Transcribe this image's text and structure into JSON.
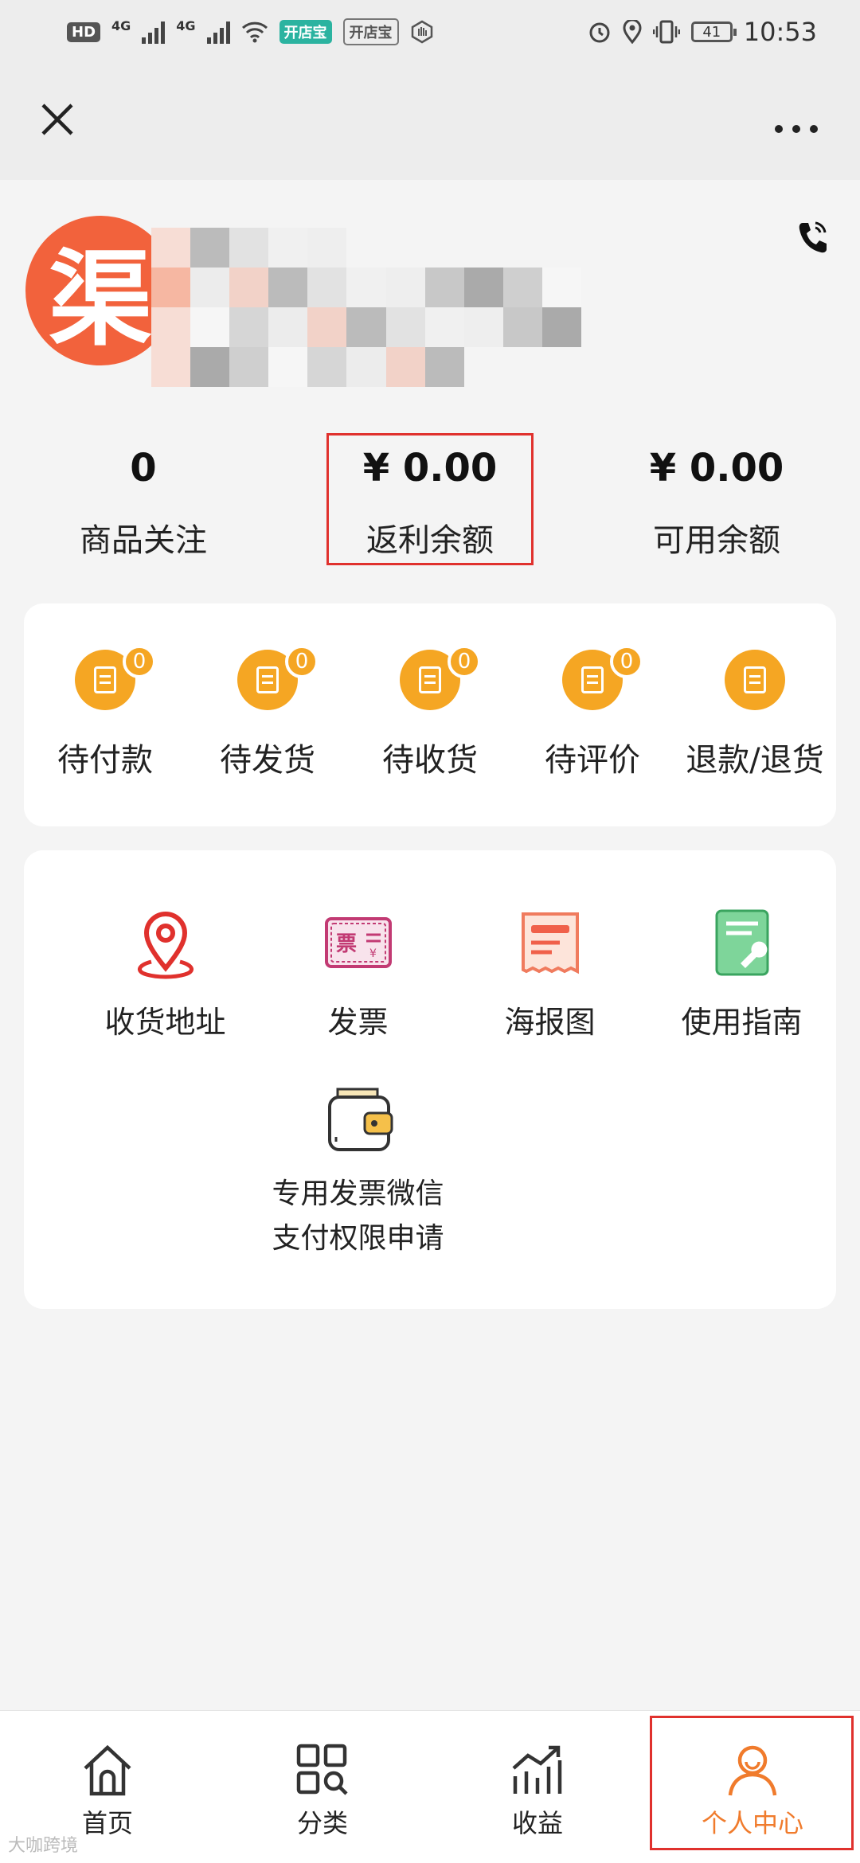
{
  "status_bar": {
    "hd_label": "HD",
    "network_1": "4G",
    "network_2": "4G",
    "app_chip_1": "开店宝",
    "app_chip_2": "开店宝",
    "battery": "41",
    "time": "10:53"
  },
  "nav": {
    "close_icon": "close-icon",
    "more_icon": "more-icon"
  },
  "profile": {
    "avatar_text": "渠",
    "phone_icon": "phone-icon"
  },
  "stats": [
    {
      "value": "0",
      "label": "商品关注"
    },
    {
      "value": "¥ 0.00",
      "label": "返利余额"
    },
    {
      "value": "¥ 0.00",
      "label": "可用余额"
    }
  ],
  "orders": [
    {
      "label": "待付款",
      "badge": "0"
    },
    {
      "label": "待发货",
      "badge": "0"
    },
    {
      "label": "待收货",
      "badge": "0"
    },
    {
      "label": "待评价",
      "badge": "0"
    },
    {
      "label": "退款/退货",
      "badge": ""
    }
  ],
  "services": [
    {
      "label": "收货地址",
      "icon": "location-pin-icon"
    },
    {
      "label": "发票",
      "icon": "invoice-icon"
    },
    {
      "label": "海报图",
      "icon": "poster-icon"
    },
    {
      "label": "使用指南",
      "icon": "guide-icon"
    },
    {
      "label_line1": "专用发票微信",
      "label_line2": "支付权限申请",
      "icon": "wallet-icon"
    }
  ],
  "tabs": [
    {
      "label": "首页",
      "icon": "home-icon"
    },
    {
      "label": "分类",
      "icon": "category-icon"
    },
    {
      "label": "收益",
      "icon": "earnings-icon"
    },
    {
      "label": "个人中心",
      "icon": "user-icon"
    }
  ],
  "watermark": "大咖跨境",
  "colors": {
    "accent_orange": "#f5a623",
    "avatar_bg": "#f2623c",
    "active_tab": "#f07b2c",
    "highlight_red": "#e0312d"
  }
}
